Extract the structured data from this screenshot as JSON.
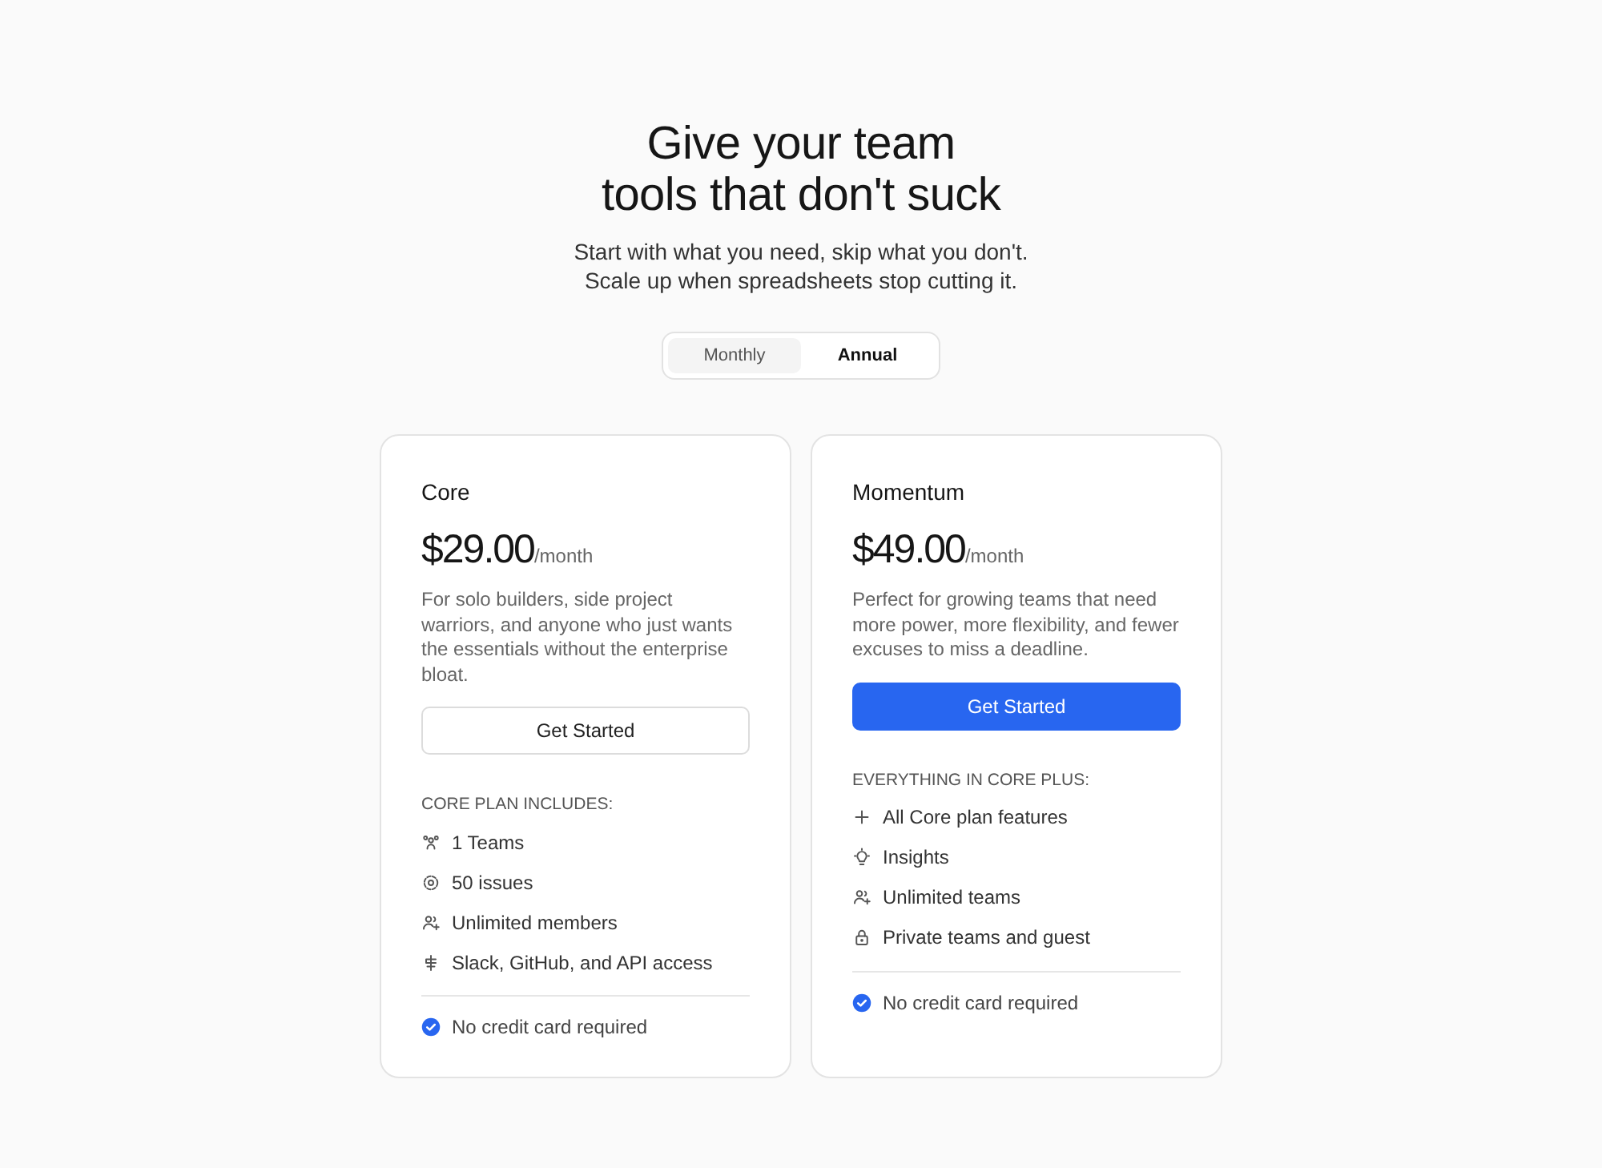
{
  "heading": {
    "lines": [
      "Give your team",
      "tools that don't suck"
    ],
    "subtitle_lines": [
      "Start with what you need, skip what you don't.",
      "Scale up when spreadsheets stop cutting it."
    ]
  },
  "billing_toggle": [
    {
      "label": "Monthly",
      "selected": false
    },
    {
      "label": "Annual",
      "selected": true
    }
  ],
  "plans": [
    {
      "name": "Core",
      "price": "$29.00",
      "period": "/month",
      "description": "For solo builders, side project warriors, and anyone who just wants the essentials without the enterprise bloat.",
      "button": {
        "label": "Get Started",
        "kind": "outline"
      },
      "features_title": "CORE PLAN INCLUDES:",
      "features": [
        {
          "label": "1 Teams",
          "kind": "people"
        },
        {
          "label": "50 issues",
          "kind": "target"
        },
        {
          "label": "Unlimited members",
          "kind": "user-add"
        },
        {
          "label": "Slack, GitHub, and API access",
          "kind": "plug"
        }
      ],
      "note": "No credit card required"
    },
    {
      "name": "Momentum",
      "price": "$49.00",
      "period": "/month",
      "description": "Perfect for growing teams that need more power, more flexibility, and fewer excuses to miss a deadline.",
      "button": {
        "label": "Get Started",
        "kind": "primary"
      },
      "features_title": "EVERYTHING IN CORE PLUS:",
      "features": [
        {
          "label": "All Core plan features",
          "kind": "plus"
        },
        {
          "label": "Insights",
          "kind": "bulb"
        },
        {
          "label": "Unlimited teams",
          "kind": "user-add"
        },
        {
          "label": "Private teams and guest",
          "kind": "lock"
        }
      ],
      "note": "No credit card required"
    }
  ]
}
